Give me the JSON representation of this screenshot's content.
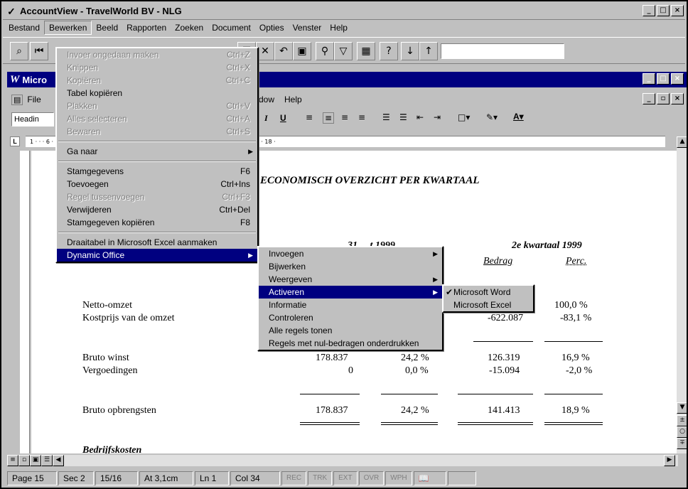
{
  "app": {
    "title": "AccountView - TravelWorld BV - NLG"
  },
  "main_menu": [
    "Bestand",
    "Bewerken",
    "Beeld",
    "Rapporten",
    "Zoeken",
    "Document",
    "Opties",
    "Venster",
    "Help"
  ],
  "word": {
    "title": "Micro",
    "menu": [
      "File",
      "dow",
      "Help"
    ],
    "style_box": "Headin",
    "ruler_ticks": "1 · · · 6 · ı · 7 · ı · 8 · ı · 9 · ı · 10 · ı · 11 · ı · 12 · ı · 13 · ı · 14 · ı · 15 · ı · 16 · ı · △ · ı · 18 ·"
  },
  "bewerken_menu": {
    "items": [
      {
        "label": "Invoer ongedaan maken",
        "shortcut": "Ctrl+Z",
        "disabled": true
      },
      {
        "label": "Knippen",
        "shortcut": "Ctrl+X",
        "disabled": true
      },
      {
        "label": "Kopiëren",
        "shortcut": "Ctrl+C",
        "disabled": true
      },
      {
        "label": "Tabel kopiëren",
        "shortcut": "",
        "disabled": false
      },
      {
        "label": "Plakken",
        "shortcut": "Ctrl+V",
        "disabled": true
      },
      {
        "label": "Alles selecteren",
        "shortcut": "Ctrl+A",
        "disabled": true
      },
      {
        "label": "Bewaren",
        "shortcut": "Ctrl+S",
        "disabled": true
      },
      {
        "label": "Ga naar",
        "shortcut": "",
        "disabled": false,
        "submenu": true
      },
      {
        "label": "Stamgegevens",
        "shortcut": "F6",
        "disabled": false
      },
      {
        "label": "Toevoegen",
        "shortcut": "Ctrl+Ins",
        "disabled": false
      },
      {
        "label": "Regel tussenvoegen",
        "shortcut": "Ctrl+F3",
        "disabled": true
      },
      {
        "label": "Verwijderen",
        "shortcut": "Ctrl+Del",
        "disabled": false
      },
      {
        "label": "Stamgegeven kopiëren",
        "shortcut": "F8",
        "disabled": false
      },
      {
        "label": "Draaitabel in Microsoft Excel aanmaken",
        "shortcut": "",
        "disabled": false
      },
      {
        "label": "Dynamic Office",
        "shortcut": "",
        "disabled": false,
        "submenu": true,
        "highlighted": true
      }
    ]
  },
  "dynamic_office_menu": {
    "items": [
      {
        "label": "Invoegen",
        "submenu": true
      },
      {
        "label": "Bijwerken",
        "submenu": false
      },
      {
        "label": "Weergeven",
        "submenu": true
      },
      {
        "label": "Activeren",
        "submenu": true,
        "highlighted": true
      },
      {
        "label": "Informatie",
        "submenu": false
      },
      {
        "label": "Controleren",
        "submenu": false
      },
      {
        "label": "Alle regels tonen",
        "submenu": false
      },
      {
        "label": "Regels met nul-bedragen onderdrukken",
        "submenu": false
      }
    ]
  },
  "activeren_menu": {
    "items": [
      {
        "label": "Microsoft Word",
        "checked": true
      },
      {
        "label": "Microsoft Excel",
        "checked": false
      }
    ]
  },
  "document": {
    "heading": "ECONOMISCH OVERZICHT PER KWARTAAL",
    "col_header_partial": "31 ... t 1999",
    "col_header_q2": "2e kwartaal 1999",
    "col_sub_bedrag": "Bedrag",
    "col_sub_perc": "Perc.",
    "rows": [
      {
        "label": "Netto-omzet",
        "c1": "",
        "c2": "",
        "c3": "",
        "c4": "100,0 %"
      },
      {
        "label": "Kostprijs van de omzet",
        "c1": "",
        "c2": "",
        "c3": "-622.087",
        "c4": "-83,1 %"
      },
      {
        "label": "Bruto winst",
        "c1": "178.837",
        "c2": "24,2 %",
        "c3": "126.319",
        "c4": "16,9 %"
      },
      {
        "label": "Vergoedingen",
        "c1": "0",
        "c2": "0,0 %",
        "c3": "-15.094",
        "c4": "-2,0 %"
      },
      {
        "label": "Bruto opbrengsten",
        "c1": "178.837",
        "c2": "24,2 %",
        "c3": "141.413",
        "c4": "18,9 %"
      }
    ],
    "section": "Bedrijfskosten"
  },
  "status": {
    "page": "Page 15",
    "sec": "Sec 2",
    "pages": "15/16",
    "at": "At 3,1cm",
    "ln": "Ln 1",
    "col": "Col 34",
    "rec": "REC",
    "trk": "TRK",
    "ext": "EXT",
    "ovr": "OVR",
    "wph": "WPH"
  }
}
